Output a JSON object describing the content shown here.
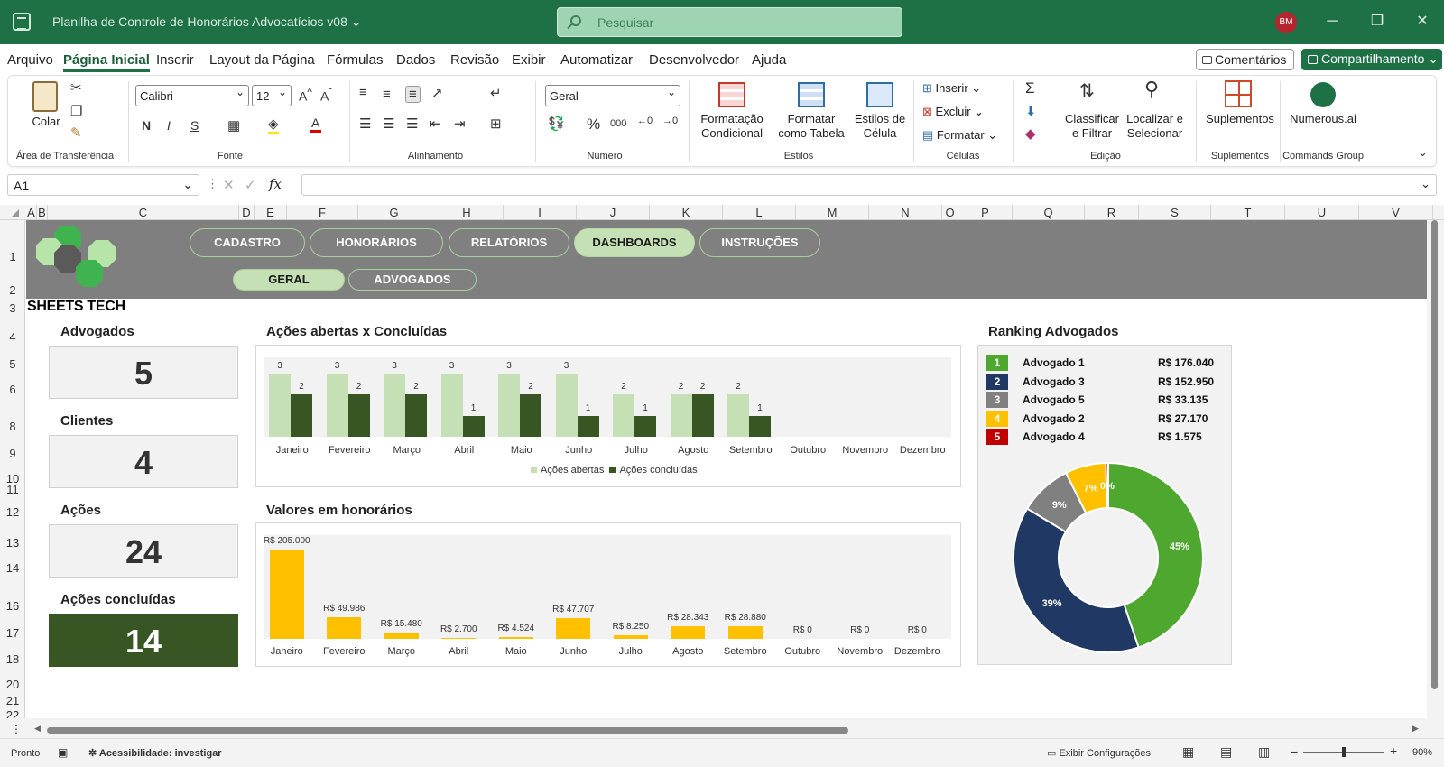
{
  "window": {
    "title": "Planilha de Controle de Honorários Advocatícios v08",
    "title_chevron": "⌄",
    "search_placeholder": "Pesquisar",
    "avatar_initials": "BM",
    "minimize": "─",
    "restore": "❐",
    "close": "✕"
  },
  "menu": {
    "items": [
      "Arquivo",
      "Página Inicial",
      "Inserir",
      "Layout da Página",
      "Fórmulas",
      "Dados",
      "Revisão",
      "Exibir",
      "Automatizar",
      "Desenvolvedor",
      "Ajuda"
    ],
    "active": "Página Inicial",
    "comments": "Comentários",
    "share": "Compartilhamento"
  },
  "ribbon": {
    "clipboard": {
      "paste": "Colar",
      "group": "Área de Transferência"
    },
    "font": {
      "name": "Calibri",
      "size": "12",
      "group": "Fonte",
      "bold": "N",
      "italic": "I",
      "underline": "S"
    },
    "alignment": {
      "group": "Alinhamento"
    },
    "number": {
      "format": "Geral",
      "percent": "%",
      "thousands": "000",
      "group": "Número"
    },
    "styles": {
      "conditional": "Formatação Condicional",
      "table": "Formatar como Tabela",
      "cell": "Estilos de Célula",
      "group": "Estilos"
    },
    "cells": {
      "insert": "Inserir",
      "delete": "Excluir",
      "format": "Formatar",
      "group": "Células"
    },
    "editing": {
      "sort": "Classificar e Filtrar",
      "find": "Localizar e Selecionar",
      "group": "Edição"
    },
    "addins": {
      "label": "Suplementos",
      "group": "Suplementos"
    },
    "numerous": {
      "label": "Numerous.ai",
      "group": "Commands Group"
    }
  },
  "formula_bar": {
    "name_box": "A1",
    "fx": "fx",
    "value": ""
  },
  "columns": [
    "A",
    "B",
    "C",
    "D",
    "E",
    "F",
    "G",
    "H",
    "I",
    "J",
    "K",
    "L",
    "M",
    "N",
    "O",
    "P",
    "Q",
    "R",
    "S",
    "T",
    "U",
    "V"
  ],
  "rows": [
    "1",
    "2",
    "3",
    "4",
    "5",
    "6",
    "8",
    "9",
    "10",
    "11",
    "12",
    "13",
    "14",
    "16",
    "17",
    "18",
    "20",
    "21",
    "22"
  ],
  "dashboard": {
    "nav": [
      "CADASTRO",
      "HONORÁRIOS",
      "RELATÓRIOS",
      "DASHBOARDS",
      "INSTRUÇÕES"
    ],
    "nav_active": "DASHBOARDS",
    "subnav": [
      "GERAL",
      "ADVOGADOS"
    ],
    "subnav_active": "GERAL",
    "logo_text": "SHEETS TECH",
    "kpis": [
      {
        "label": "Advogados",
        "value": "5"
      },
      {
        "label": "Clientes",
        "value": "4"
      },
      {
        "label": "Ações",
        "value": "24"
      },
      {
        "label": "Ações concluídas",
        "value": "14"
      }
    ],
    "ranking_title": "Ranking Advogados",
    "ranking": [
      {
        "pos": "1",
        "name": "Advogado 1",
        "value": "R$ 176.040",
        "color": "#4ea72e"
      },
      {
        "pos": "2",
        "name": "Advogado 3",
        "value": "R$ 152.950",
        "color": "#1f3864"
      },
      {
        "pos": "3",
        "name": "Advogado 5",
        "value": "R$ 33.135",
        "color": "#808080"
      },
      {
        "pos": "4",
        "name": "Advogado 2",
        "value": "R$ 27.170",
        "color": "#ffc000"
      },
      {
        "pos": "5",
        "name": "Advogado 4",
        "value": "R$ 1.575",
        "color": "#c00000"
      }
    ]
  },
  "chart_data": [
    {
      "type": "bar",
      "title": "Ações abertas x Concluídas",
      "categories": [
        "Janeiro",
        "Fevereiro",
        "Março",
        "Abril",
        "Maio",
        "Junho",
        "Julho",
        "Agosto",
        "Setembro",
        "Outubro",
        "Novembro",
        "Dezembro"
      ],
      "series": [
        {
          "name": "Ações abertas",
          "values": [
            3,
            3,
            3,
            3,
            3,
            3,
            2,
            2,
            2,
            0,
            0,
            0
          ],
          "color": "#c5e0b4"
        },
        {
          "name": "Ações concluídas",
          "values": [
            2,
            2,
            2,
            1,
            2,
            1,
            1,
            2,
            1,
            0,
            0,
            0
          ],
          "color": "#375623"
        }
      ],
      "ylim": [
        0,
        3
      ],
      "legend": "bottom"
    },
    {
      "type": "bar",
      "title": "Valores em honorários",
      "categories": [
        "Janeiro",
        "Fevereiro",
        "Março",
        "Abril",
        "Maio",
        "Junho",
        "Julho",
        "Agosto",
        "Setembro",
        "Outubro",
        "Novembro",
        "Dezembro"
      ],
      "values": [
        205000,
        49986,
        15480,
        2700,
        4524,
        47707,
        8250,
        28343,
        28880,
        0,
        0,
        0
      ],
      "labels": [
        "R$ 205.000",
        "R$ 49.986",
        "R$ 15.480",
        "R$ 2.700",
        "R$ 4.524",
        "R$ 47.707",
        "R$ 8.250",
        "R$ 28.343",
        "R$ 28.880",
        "R$ 0",
        "R$ 0",
        "R$ 0"
      ],
      "color": "#ffc000",
      "ylim": [
        0,
        205000
      ]
    },
    {
      "type": "pie",
      "donut": true,
      "slices": [
        {
          "value": 45,
          "label": "45%",
          "color": "#4ea72e"
        },
        {
          "value": 39,
          "label": "39%",
          "color": "#1f3864"
        },
        {
          "value": 9,
          "label": "9%",
          "color": "#808080"
        },
        {
          "value": 7,
          "label": "7%",
          "color": "#ffc000"
        },
        {
          "value": 0.4,
          "label": "0%",
          "color": "#c00000"
        }
      ]
    }
  ],
  "status": {
    "ready": "Pronto",
    "accessibility": "Acessibilidade: investigar",
    "display_settings": "Exibir Configurações",
    "zoom": "90%",
    "zoom_minus": "−",
    "zoom_plus": "+"
  }
}
